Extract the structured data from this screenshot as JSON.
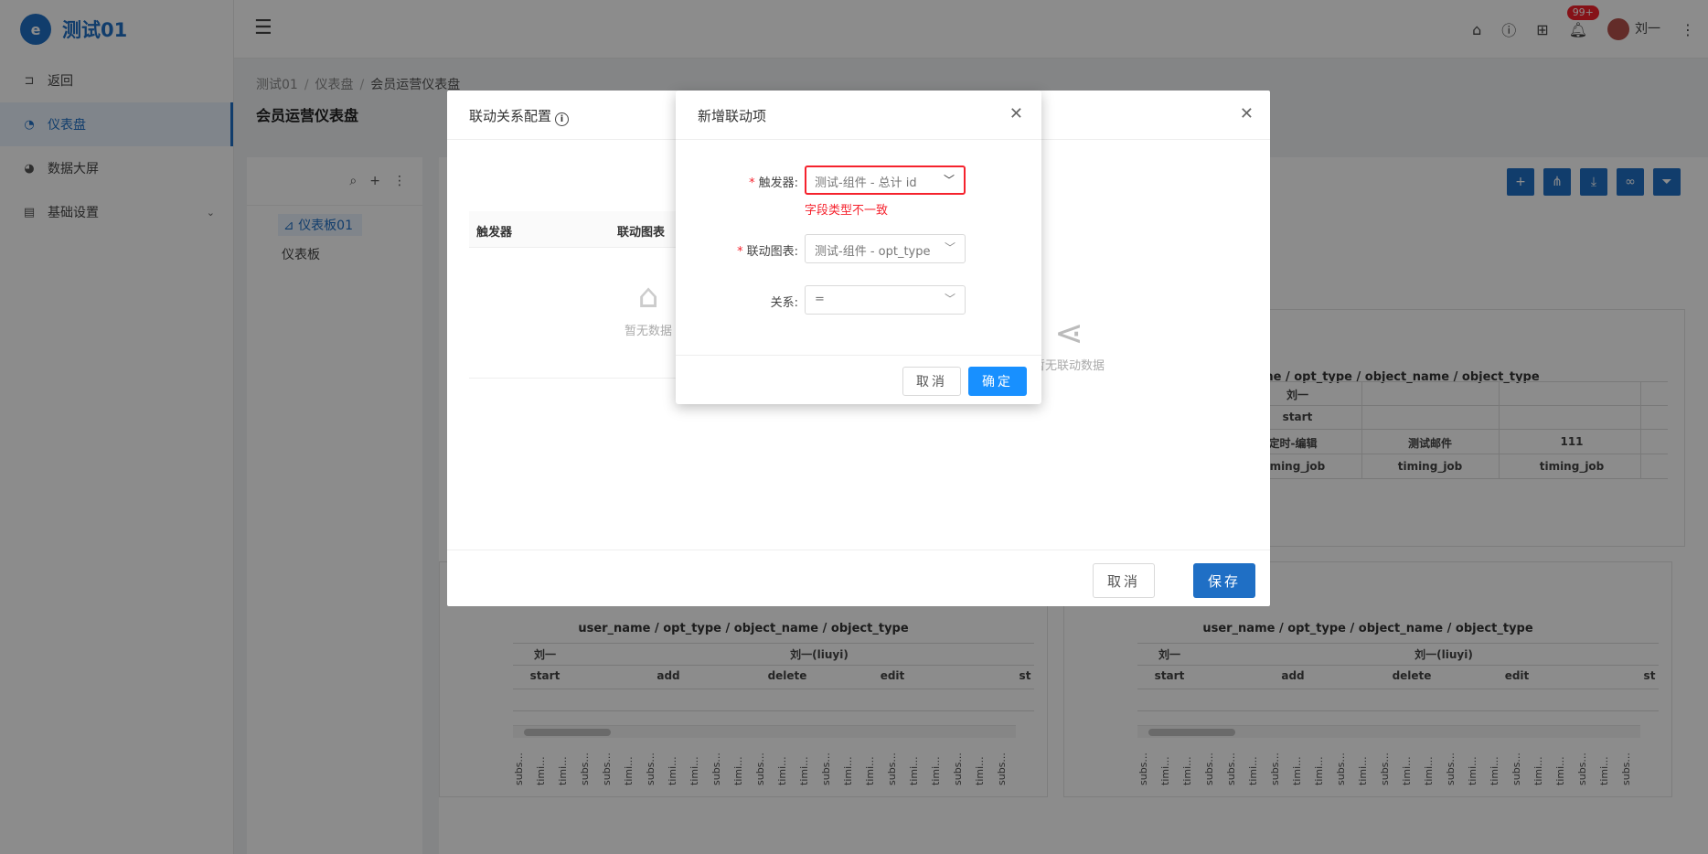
{
  "app": {
    "logo_letter": "e",
    "title": "测试01"
  },
  "sidebar": {
    "items": [
      {
        "label": "返回",
        "icon": "back-icon"
      },
      {
        "label": "仪表盘",
        "icon": "dashboard-icon",
        "active": true
      },
      {
        "label": "数据大屏",
        "icon": "pie-chart-icon"
      },
      {
        "label": "基础设置",
        "icon": "settings-icon",
        "expandable": true
      }
    ]
  },
  "header": {
    "notification_badge": "99+",
    "user_name": "刘一"
  },
  "breadcrumb": [
    "测试01",
    "仪表盘",
    "会员运营仪表盘"
  ],
  "page_title": "会员运营仪表盘",
  "tree": {
    "nodes": [
      {
        "label": "仪表板01",
        "selected": true
      },
      {
        "label": "仪表板"
      }
    ]
  },
  "widgets": {
    "top_right": {
      "title": "user_name / opt_type / object_name / object_type",
      "row1": "刘一",
      "row2": "start",
      "row3": [
        "定时-编辑",
        "测试邮件",
        "111"
      ],
      "row4": [
        "timing_job",
        "timing_job",
        "timing_job"
      ]
    },
    "bottom_left": {
      "title": "user_name / opt_type / object_name / object_type",
      "user1": "刘一",
      "user2": "刘一(liuyi)",
      "ops": [
        "start",
        "add",
        "delete",
        "edit",
        "st"
      ],
      "rotated": [
        "subs...",
        "timi...",
        "timi...",
        "subs...",
        "subs...",
        "timi...",
        "subs...",
        "timi...",
        "timi...",
        "subs...",
        "timi...",
        "subs...",
        "timi...",
        "timi...",
        "subs...",
        "timi...",
        "timi...",
        "subs...",
        "timi...",
        "timi...",
        "subs...",
        "timi...",
        "subs..."
      ]
    },
    "bottom_right": {
      "title": "user_name / opt_type / object_name / object_type",
      "user1": "刘一",
      "user2": "刘一(liuyi)",
      "ops": [
        "start",
        "add",
        "delete",
        "edit",
        "st"
      ],
      "rotated": [
        "subs...",
        "timi...",
        "timi...",
        "subs...",
        "subs...",
        "timi...",
        "subs...",
        "timi...",
        "timi...",
        "subs...",
        "timi...",
        "subs...",
        "timi...",
        "timi...",
        "subs...",
        "timi...",
        "timi...",
        "subs...",
        "timi...",
        "timi...",
        "subs...",
        "timi...",
        "subs..."
      ]
    }
  },
  "linkage_dialog": {
    "title": "联动关系配置",
    "col_trigger": "触发器",
    "col_chart": "联动图表",
    "empty_left": "暂无数据",
    "empty_right": "暂无联动数据",
    "cancel": "取消",
    "save": "保存"
  },
  "add_dialog": {
    "title": "新增联动项",
    "trigger_label": "触发器:",
    "trigger_value": "测试-组件 - 总计 id",
    "trigger_error": "字段类型不一致",
    "chart_label": "联动图表:",
    "chart_value": "测试-组件 - opt_type",
    "relation_label": "关系:",
    "relation_value": "=",
    "cancel": "取消",
    "ok": "确定"
  },
  "colors": {
    "primary": "#1f6fc5",
    "error": "#f5222d",
    "ok_button": "#1890ff"
  }
}
